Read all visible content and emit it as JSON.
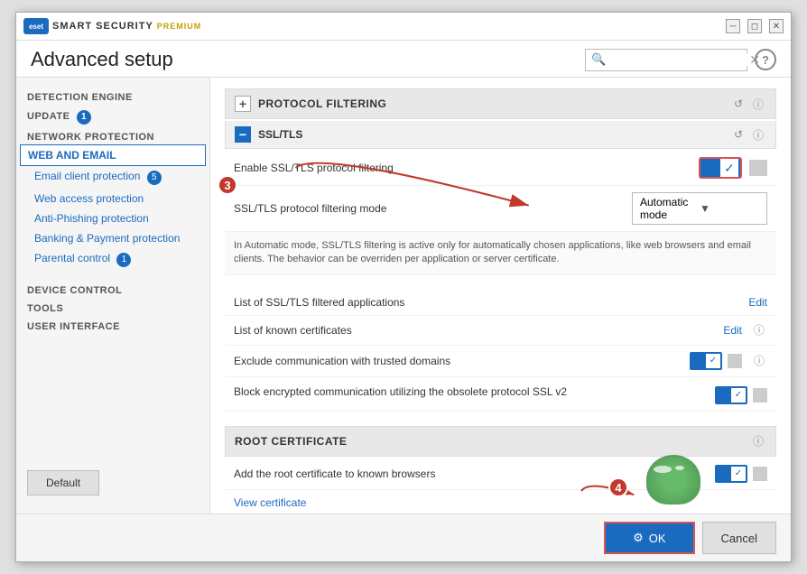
{
  "app": {
    "logo_text": "SMART SECURITY",
    "logo_premium": "PREMIUM",
    "title": "Advanced setup"
  },
  "header": {
    "search_placeholder": "",
    "help_label": "?"
  },
  "sidebar": {
    "sections": [
      {
        "id": "detection-engine",
        "label": "DETECTION ENGINE"
      },
      {
        "id": "update",
        "label": "UPDATE",
        "badge": "1"
      },
      {
        "id": "network-protection",
        "label": "NETWORK PROTECTION"
      },
      {
        "id": "web-and-email",
        "label": "WEB AND EMAIL",
        "active": true
      }
    ],
    "subitems": [
      {
        "id": "email-client",
        "label": "Email client protection",
        "badge": "5"
      },
      {
        "id": "web-access",
        "label": "Web access protection"
      },
      {
        "id": "anti-phishing",
        "label": "Anti-Phishing protection"
      },
      {
        "id": "banking",
        "label": "Banking & Payment protection"
      },
      {
        "id": "parental",
        "label": "Parental control",
        "badge": "1"
      }
    ],
    "more_sections": [
      {
        "id": "device-control",
        "label": "DEVICE CONTROL"
      },
      {
        "id": "tools",
        "label": "TOOLS"
      },
      {
        "id": "user-interface",
        "label": "USER INTERFACE"
      }
    ],
    "default_btn": "Default"
  },
  "main": {
    "protocol_filtering": {
      "title": "PROTOCOL FILTERING",
      "ssl_tls": {
        "title": "SSL/TLS",
        "enable_label": "Enable SSL/TLS protocol filtering",
        "mode_label": "SSL/TLS protocol filtering mode",
        "mode_value": "Automatic mode",
        "info_text": "In Automatic mode, SSL/TLS filtering is active only for automatically chosen applications, like web browsers and email clients. The behavior can be overriden per application or server certificate.",
        "list_apps_label": "List of SSL/TLS filtered applications",
        "list_apps_edit": "Edit",
        "list_certs_label": "List of known certificates",
        "list_certs_edit": "Edit",
        "exclude_trusted_label": "Exclude communication with trusted domains",
        "block_ssl_label": "Block encrypted communication utilizing the obsolete protocol SSL v2"
      }
    },
    "root_certificate": {
      "title": "ROOT CERTIFICATE",
      "add_label": "Add the root certificate to known browsers",
      "view_link": "View certificate"
    }
  },
  "footer": {
    "ok_label": "OK",
    "cancel_label": "Cancel"
  }
}
